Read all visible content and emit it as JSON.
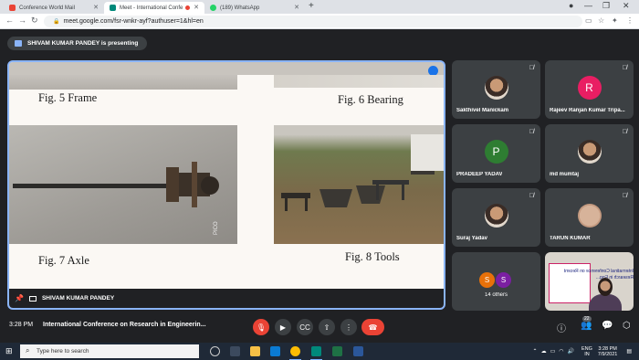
{
  "browser": {
    "tabs": [
      {
        "label": "Conference World Mail",
        "favicon_color": "#ea4335"
      },
      {
        "label": "Meet - International Confe",
        "favicon_color": "#00897b"
      },
      {
        "label": "(189) WhatsApp",
        "favicon_color": "#25d366"
      }
    ],
    "new_tab_label": "+",
    "url": "meet.google.com/fsr-wnkr-ayf?authuser=1&hl=en",
    "window_controls": [
      "—",
      "❐",
      "✕"
    ]
  },
  "meet": {
    "presenting_banner": "SHIVAM KUMAR PANDEY is presenting",
    "slide": {
      "figures": [
        "Fig. 5  Frame",
        "Fig. 6  Bearing",
        "Fig. 7  Axle",
        "Fig. 8  Tools"
      ],
      "watermark": "PICO"
    },
    "presenter_footer": "SHIVAM KUMAR PANDEY",
    "participants": [
      {
        "name": "Sakthivel Manickam",
        "initial": "",
        "avatar_color": "#ffffff"
      },
      {
        "name": "Rajeev Ranjan Kumar Tripa...",
        "initial": "R",
        "avatar_color": "#e91e63"
      },
      {
        "name": "PRADEEP YADAV",
        "initial": "P",
        "avatar_color": "#2e7d32"
      },
      {
        "name": "md mumtaj",
        "initial": "",
        "avatar_color": "#ffffff"
      },
      {
        "name": "Suraj Yadav",
        "initial": "",
        "avatar_color": "#ffffff"
      },
      {
        "name": "TARUN KUMAR",
        "initial": "",
        "avatar_color": "#d7b39a"
      }
    ],
    "others": {
      "label": "14 others",
      "initials": [
        "S",
        "S"
      ]
    },
    "self_card_text": "Internatinal Conference on Recent Research in Eng...",
    "bottom_bar": {
      "time": "3:28 PM",
      "meeting_title": "International Conference on Research in Engineerin...",
      "people_count": "22"
    }
  },
  "taskbar": {
    "search_placeholder": "Type here to search",
    "language_line1": "ENG",
    "language_line2": "IN",
    "time": "3:28 PM",
    "date": "7/9/2021"
  },
  "colors": {
    "accent_blue": "#8ab4f8",
    "meet_dark": "#202124",
    "tile_gray": "#3c4043",
    "mic_off_red": "#ea4335"
  }
}
